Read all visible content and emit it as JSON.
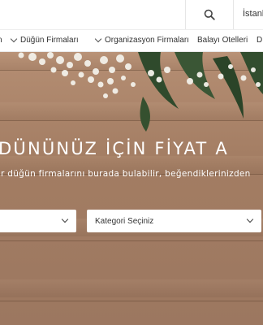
{
  "header": {
    "search_icon": "search-icon",
    "city": "İstanbul"
  },
  "nav": {
    "items": [
      {
        "label": "n",
        "chevron": false
      },
      {
        "label": "Düğün Firmaları",
        "chevron": true
      },
      {
        "label": "Organizasyon Firmaları",
        "chevron": true
      },
      {
        "label": "Balayı Otelleri",
        "chevron": false
      },
      {
        "label": "D",
        "chevron": false
      }
    ]
  },
  "hero": {
    "title": "DÜNÜNÜZ İÇİN FİYAT A",
    "subtitle": "r düğün firmalarını burada bulabilir, beğendiklerinizden",
    "select_left": "",
    "select_category": "Kategori Seçiniz"
  },
  "colors": {
    "wood": "#a37d63",
    "leaf": "#2f4a2c",
    "flower": "#f2f2ee"
  }
}
